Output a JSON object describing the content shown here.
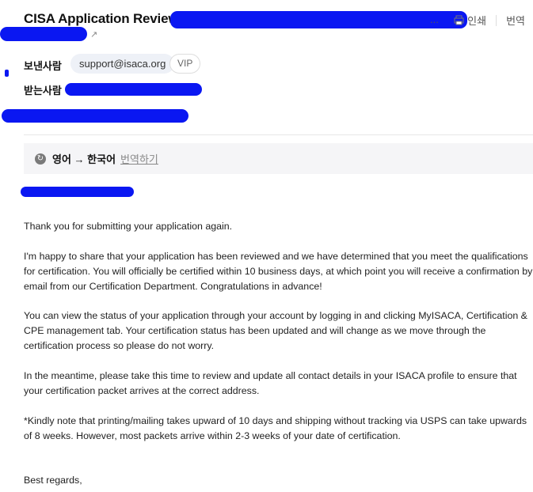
{
  "header": {
    "subject": "CISA Application Review [",
    "subject_ellipsis": "...",
    "print_label": "인쇄",
    "translate_label": "번역"
  },
  "meta": {
    "sender_label": "보낸사람",
    "sender_email": "support@isaca.org",
    "vip_label": "VIP",
    "recipient_label": "받는사람"
  },
  "translate_bar": {
    "languages": "영어 → 한국어",
    "action_label": "번역하기"
  },
  "body": {
    "paragraphs": [
      "Thank you for submitting your application again.",
      "I'm happy to share that your application has been reviewed and we have determined that you meet the qualifications for certification. You will officially be certified within 10 business days, at which point you will receive a confirmation by email from our Certification Department. Congratulations in advance!",
      "You can view the status of your application through your account by logging in and clicking MyISACA, Certification & CPE management tab. Your certification status has been updated and will change as we move through the certification process so please do not worry.",
      "In the meantime, please take this time to review and update all contact details in your ISACA profile to ensure that your certification packet arrives at the correct address.",
      "*Kindly note that printing/mailing takes upward of 10 days and shipping without tracking via USPS can take upwards of 8 weeks. However, most packets arrive within 2-3 weeks of your date of certification."
    ],
    "closing": "Best regards,"
  }
}
